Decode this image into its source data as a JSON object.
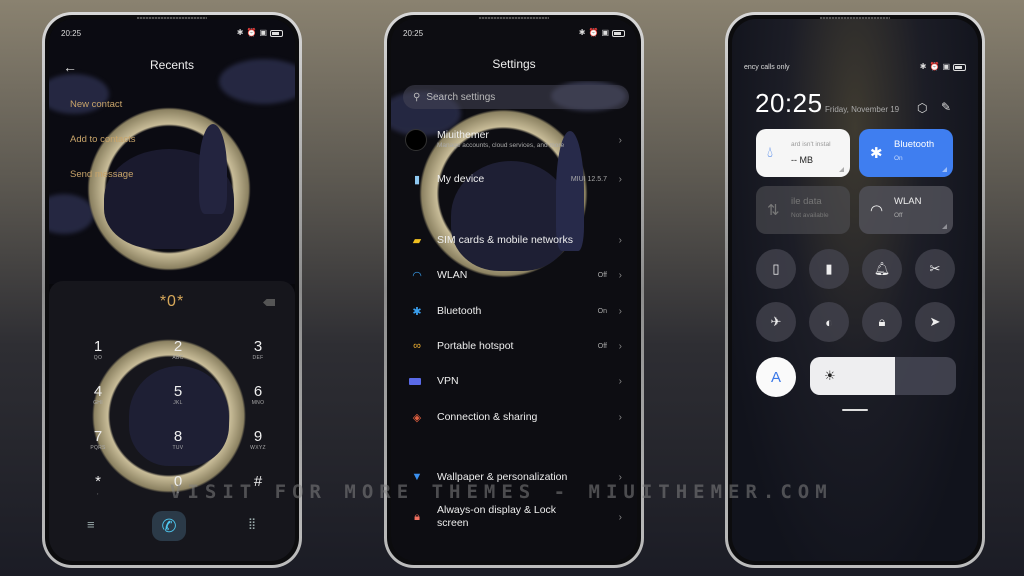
{
  "status_bar": {
    "time": "20:25"
  },
  "recents": {
    "title": "Recents",
    "menu": [
      "New contact",
      "Add to contacts",
      "Send message"
    ],
    "dial_input": "*0*",
    "keys": [
      {
        "digit": "1",
        "letters": "QO"
      },
      {
        "digit": "2",
        "letters": "ABC"
      },
      {
        "digit": "3",
        "letters": "DEF"
      },
      {
        "digit": "4",
        "letters": "GHI"
      },
      {
        "digit": "5",
        "letters": "JKL"
      },
      {
        "digit": "6",
        "letters": "MNO"
      },
      {
        "digit": "7",
        "letters": "PQRS"
      },
      {
        "digit": "8",
        "letters": "TUV"
      },
      {
        "digit": "9",
        "letters": "WXYZ"
      },
      {
        "digit": "*",
        "letters": ","
      },
      {
        "digit": "0",
        "letters": "+"
      },
      {
        "digit": "#",
        "letters": ""
      }
    ],
    "icons": {
      "back": "←",
      "menu": "≡",
      "call": "✆",
      "keypad": "⣿"
    }
  },
  "settings": {
    "title": "Settings",
    "search_placeholder": "Search settings",
    "items": [
      {
        "label": "Miuithemer",
        "sub": "Manage accounts, cloud services, and more",
        "value": "",
        "icon": "account",
        "color": "#dddddd"
      },
      {
        "label": "My device",
        "sub": "",
        "value": "MIUI 12.5.7",
        "icon": "device",
        "color": "#8ec8f0"
      },
      {
        "label": "SIM cards & mobile networks",
        "sub": "",
        "value": "",
        "icon": "sim",
        "color": "#f0c020"
      },
      {
        "label": "WLAN",
        "sub": "",
        "value": "Off",
        "icon": "wifi",
        "color": "#3aa0f0"
      },
      {
        "label": "Bluetooth",
        "sub": "",
        "value": "On",
        "icon": "bluetooth",
        "color": "#3aa0f0"
      },
      {
        "label": "Portable hotspot",
        "sub": "",
        "value": "Off",
        "icon": "hotspot",
        "color": "#f0b030"
      },
      {
        "label": "VPN",
        "sub": "",
        "value": "",
        "icon": "vpn",
        "color": "#5a6ae8"
      },
      {
        "label": "Connection & sharing",
        "sub": "",
        "value": "",
        "icon": "share",
        "color": "#e06040"
      },
      {
        "label": "Wallpaper & personalization",
        "sub": "",
        "value": "",
        "icon": "wallpaper",
        "color": "#3a90f0"
      },
      {
        "label": "Always-on display & Lock screen",
        "sub": "",
        "value": "",
        "icon": "lock",
        "color": "#f07060"
      }
    ]
  },
  "control_center": {
    "carrier": "ency calls only",
    "time": "20:25",
    "date": "Friday, November 19",
    "tiles": [
      {
        "title": "ard isn't instal",
        "sub": "-- MB",
        "state": "data-usage"
      },
      {
        "title": "Bluetooth",
        "sub": "On",
        "state": "active"
      },
      {
        "title": "ile data",
        "sub": "Not available",
        "state": "disabled"
      },
      {
        "title": "WLAN",
        "sub": "Off",
        "state": "off"
      }
    ],
    "toggles": [
      "vibrate",
      "flashlight",
      "bell",
      "screenshot",
      "airplane",
      "dark-mode",
      "lock",
      "location"
    ],
    "auto_brightness_label": "A",
    "brightness_level": 0.58
  },
  "watermark": "VISIT FOR MORE THEMES - MIUITHEMER.COM"
}
